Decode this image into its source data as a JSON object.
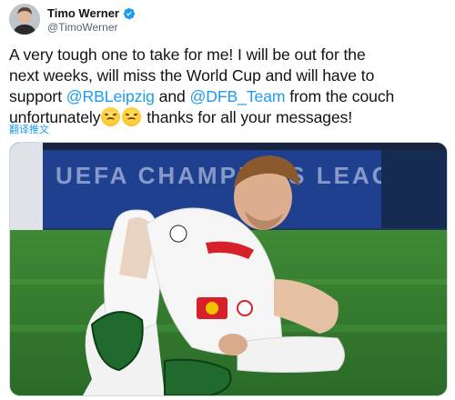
{
  "author": {
    "display_name": "Timo Werner",
    "handle": "@TimoWerner",
    "verified": true,
    "avatar_icon": "profile-photo"
  },
  "tweet": {
    "line1": "A very tough one to take for me! I will be out for the",
    "line2": "next weeks, will miss the World Cup and will have to",
    "line3_pre": "support ",
    "mention1": "@RBLeipzig",
    "line3_mid": " and ",
    "mention2": "@DFB_Team",
    "line3_post": " from the couch",
    "line4_pre": "unfortunately",
    "line4_post": " thanks for all your messages!",
    "emojis": [
      "persevering-face",
      "persevering-face"
    ]
  },
  "translate_label": "翻译推文",
  "media": {
    "banner_text": "UEFA CHAMPIONS LEAGUE",
    "shirt_sponsor": "Red Bull",
    "colors": {
      "pitch": "#2f7a2c",
      "banner": "#1f3f8f",
      "shirt": "#f4f4f4",
      "accent_red": "#d6202a"
    }
  },
  "colors": {
    "link": "#1d9bf0",
    "text": "#0f1419",
    "secondary": "#536471"
  }
}
